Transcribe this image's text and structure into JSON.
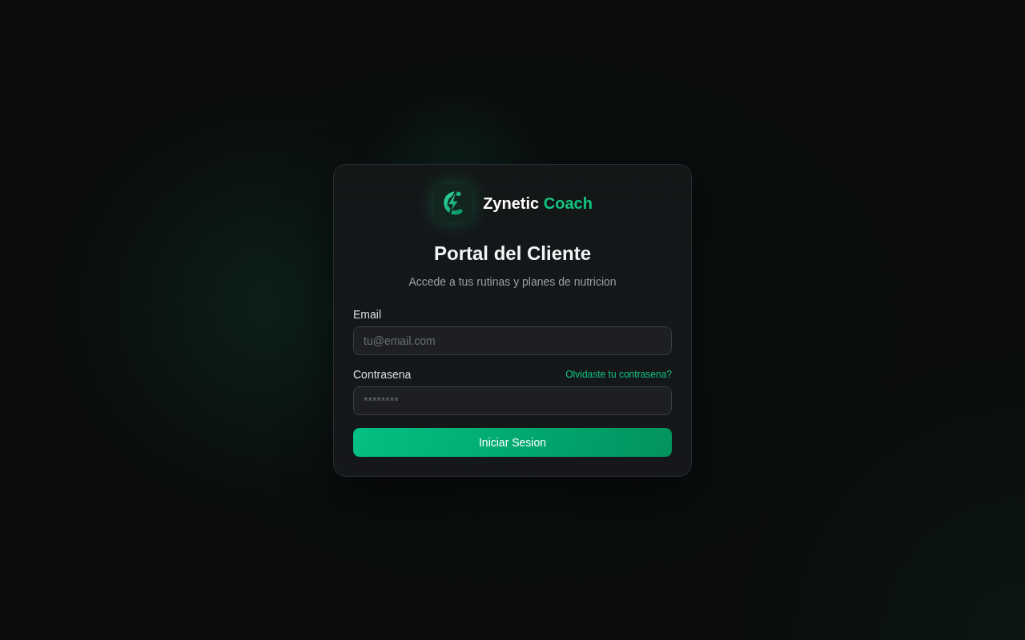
{
  "brand": {
    "name": "Zynetic",
    "accent": "Coach"
  },
  "title": "Portal del Cliente",
  "subtitle": "Accede a tus rutinas y planes de nutricion",
  "fields": [
    {
      "label": "Email",
      "placeholder": "tu@email.com"
    },
    {
      "label": "Contrasena",
      "placeholder": "********",
      "link": "Olvidaste tu contrasena?"
    }
  ],
  "submit": "Iniciar Sesion"
}
